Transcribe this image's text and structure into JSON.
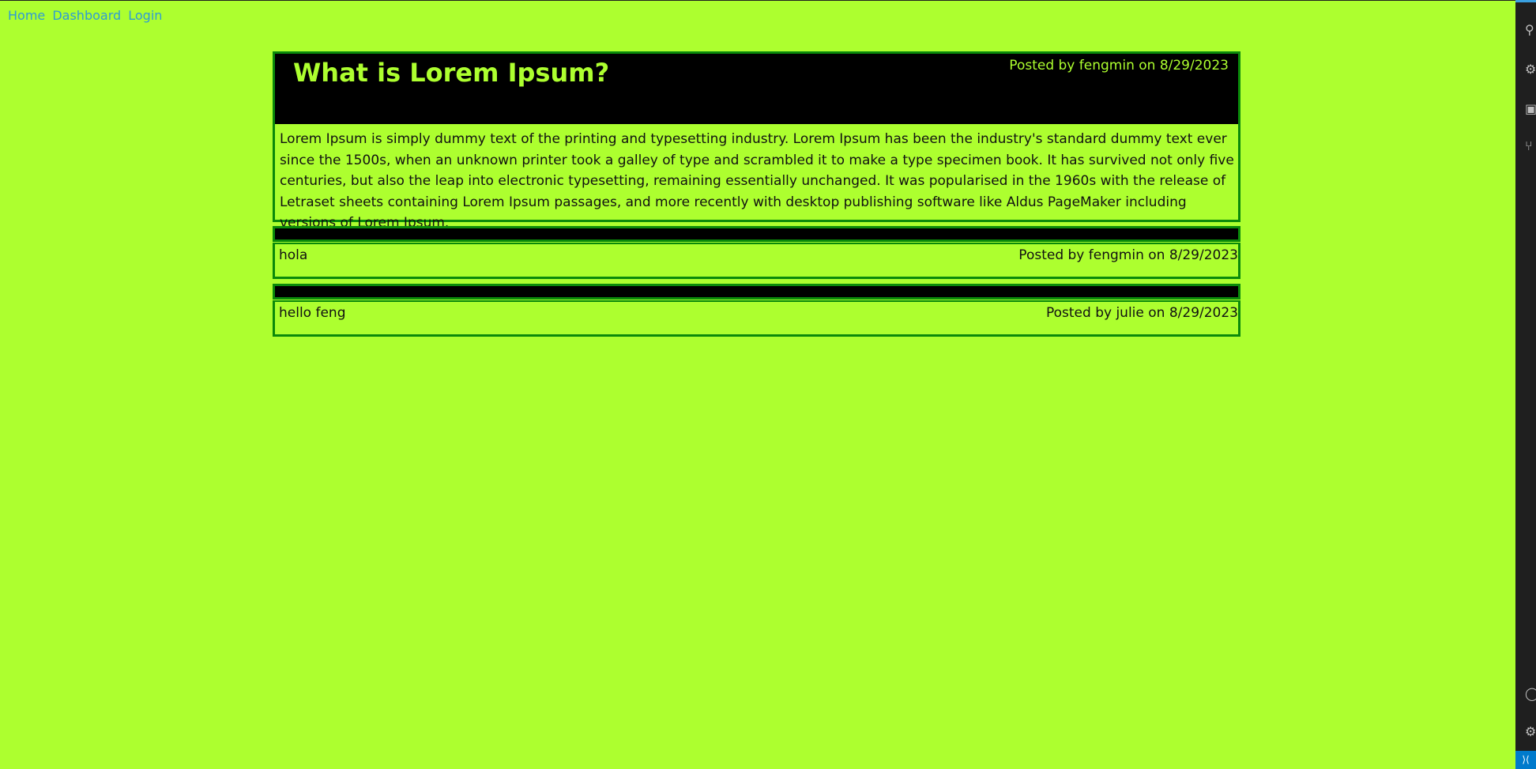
{
  "nav": {
    "home": "Home",
    "dashboard": "Dashboard",
    "login": "Login"
  },
  "posts": [
    {
      "title": "What is Lorem Ipsum?",
      "meta": "Posted by fengmin on 8/29/2023",
      "body": "Lorem Ipsum is simply dummy text of the printing and typesetting industry. Lorem Ipsum has been the industry's standard dummy text ever since the 1500s, when an unknown printer took a galley of type and scrambled it to make a type specimen book. It has survived not only five centuries, but also the leap into electronic typesetting, remaining essentially unchanged. It was popularised in the 1960s with the release of Letraset sheets containing Lorem Ipsum passages, and more recently with desktop publishing software like Aldus PageMaker including versions of Lorem Ipsum."
    },
    {
      "text": "hola",
      "meta": "Posted by fengmin on 8/29/2023"
    },
    {
      "text": "hello feng",
      "meta": "Posted by julie on 8/29/2023"
    }
  ],
  "colors": {
    "background": "#adff2f",
    "border": "#0a8a0a",
    "header": "#000000",
    "link": "#2f9bd4"
  },
  "side_icons": [
    "search-icon",
    "debug-icon",
    "extensions-icon",
    "source-control-icon",
    "account-icon",
    "settings-icon",
    "remote-icon"
  ]
}
